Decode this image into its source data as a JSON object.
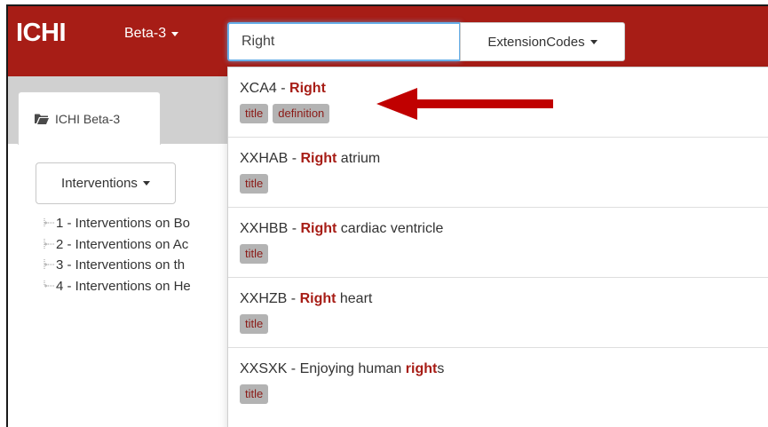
{
  "navbar": {
    "brand": "ICHI",
    "version_label": "Beta-3",
    "search_value": "Right",
    "extension_button_label": "ExtensionCodes",
    "background_color": "#a71d16"
  },
  "left_panel": {
    "tab_label": "ICHI Beta-3",
    "tab_icon": "folder-open-icon",
    "interventions_label": "Interventions",
    "tree_items": [
      "1 - Interventions on Bo",
      "2 - Interventions on Ac",
      "3 - Interventions on th",
      "4 - Interventions on He"
    ]
  },
  "results": [
    {
      "code": "XCA4",
      "sep": " - ",
      "pre": "",
      "match": "Right",
      "post": "",
      "tags": [
        "title",
        "definition"
      ]
    },
    {
      "code": "XXHAB",
      "sep": " - ",
      "pre": "",
      "match": "Right",
      "post": " atrium",
      "tags": [
        "title"
      ]
    },
    {
      "code": "XXHBB",
      "sep": " - ",
      "pre": "",
      "match": "Right",
      "post": " cardiac ventricle",
      "tags": [
        "title"
      ]
    },
    {
      "code": "XXHZB",
      "sep": " - ",
      "pre": "",
      "match": "Right",
      "post": " heart",
      "tags": [
        "title"
      ]
    },
    {
      "code": "XXSXK",
      "sep": " - ",
      "pre": "Enjoying human ",
      "match": "right",
      "post": "s",
      "tags": [
        "title"
      ]
    }
  ],
  "annotation": {
    "arrow_color": "#c00000"
  },
  "colors": {
    "highlight": "#a71d16",
    "tag_bg": "#b3b3b3",
    "input_focus": "#66afe9"
  }
}
